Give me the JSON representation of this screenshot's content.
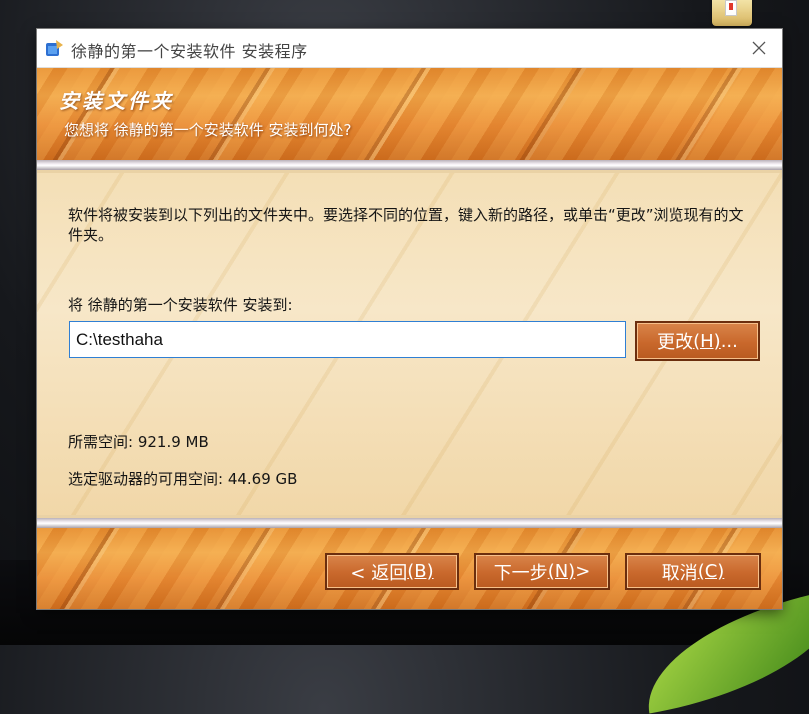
{
  "window": {
    "title": "徐静的第一个安装软件 安装程序"
  },
  "header": {
    "title": "安装文件夹",
    "subtitle": "您想将 徐静的第一个安装软件 安装到何处?"
  },
  "content": {
    "description": "软件将被安装到以下列出的文件夹中。要选择不同的位置，键入新的路径，或单击“更改”浏览现有的文件夹。",
    "install_to_label": "将 徐静的第一个安装软件 安装到:",
    "path_value": "C:\\testhaha",
    "change_button": {
      "text": "更改",
      "mnemonic": "(H)",
      "suffix": "..."
    },
    "space_required": "所需空间: 921.9 MB",
    "space_available": "选定驱动器的可用空间: 44.69 GB"
  },
  "footer": {
    "back_button": {
      "text": "< 返回",
      "mnemonic": "(B)"
    },
    "next_button": {
      "text": "下一步",
      "mnemonic": "(N)",
      "suffix": " >"
    },
    "cancel_button": {
      "text": "取消",
      "mnemonic": "(C)"
    }
  },
  "icons": {
    "app": "installer-icon",
    "close": "close-icon",
    "desktop": "folder-icon"
  },
  "colors": {
    "button_fill": "#c9682c",
    "button_border": "#6b2e0e",
    "input_border": "#2f7fd4"
  }
}
